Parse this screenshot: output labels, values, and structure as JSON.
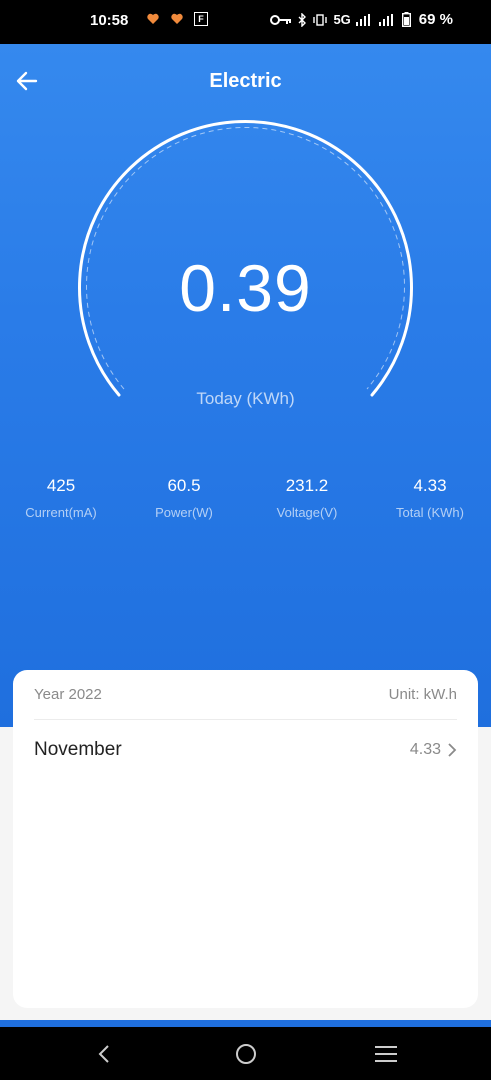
{
  "status_bar": {
    "time": "10:58",
    "network": "5G",
    "battery": "69 %",
    "icons": [
      "heart-notification-icon",
      "heart-notification-icon",
      "f-notification-icon",
      "key-icon",
      "bluetooth-icon",
      "vibrate-icon",
      "signal-icon",
      "signal-icon",
      "battery-icon"
    ]
  },
  "header": {
    "title": "Electric",
    "back_icon": "arrow-left-icon"
  },
  "gauge": {
    "value": "0.39",
    "label": "Today (KWh)"
  },
  "stats": [
    {
      "value": "425",
      "label": "Current(mA)"
    },
    {
      "value": "60.5",
      "label": "Power(W)"
    },
    {
      "value": "231.2",
      "label": "Voltage(V)"
    },
    {
      "value": "4.33",
      "label": "Total (KWh)"
    }
  ],
  "records": {
    "year_label": "Year 2022",
    "unit_label": "Unit: kW.h",
    "months": [
      {
        "name": "November",
        "value": "4.33"
      }
    ]
  },
  "nav": {
    "icons": [
      "back-triangle-icon",
      "home-circle-icon",
      "menu-lines-icon"
    ]
  },
  "colors": {
    "primary": "#2a7ce8",
    "text_muted": "#8a8a8a"
  }
}
